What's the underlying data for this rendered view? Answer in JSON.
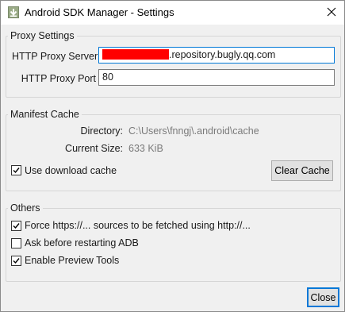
{
  "window": {
    "title": "Android SDK Manager - Settings"
  },
  "proxy": {
    "legend": "Proxy Settings",
    "server_label": "HTTP Proxy Server",
    "server_value_suffix": ".repository.bugly.qq.com",
    "port_label": "HTTP Proxy Port",
    "port_value": "80"
  },
  "manifest": {
    "legend": "Manifest Cache",
    "directory_label": "Directory:",
    "directory_value": "C:\\Users\\fnngj\\.android\\cache",
    "size_label": "Current Size:",
    "size_value": "633 KiB",
    "use_cache_label": "Use download cache",
    "use_cache_checked": true,
    "clear_button": "Clear Cache"
  },
  "others": {
    "legend": "Others",
    "options": [
      {
        "label": "Force https://... sources to be fetched using http://...",
        "checked": true
      },
      {
        "label": "Ask before restarting ADB",
        "checked": false
      },
      {
        "label": "Enable Preview Tools",
        "checked": true
      }
    ]
  },
  "footer": {
    "close_button": "Close"
  }
}
